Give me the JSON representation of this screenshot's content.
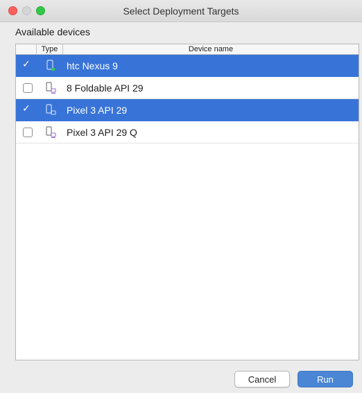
{
  "window": {
    "title": "Select Deployment Targets"
  },
  "section": {
    "label": "Available devices"
  },
  "table": {
    "columns": {
      "type": "Type",
      "name": "Device name"
    },
    "rows": [
      {
        "name": "htc Nexus 9",
        "checked": true,
        "selected": true,
        "icon": "phone-online-icon"
      },
      {
        "name": "8  Foldable API 29",
        "checked": false,
        "selected": false,
        "icon": "phone-emulator-icon"
      },
      {
        "name": "Pixel 3 API 29",
        "checked": true,
        "selected": true,
        "icon": "phone-emulator-icon"
      },
      {
        "name": "Pixel 3 API 29 Q",
        "checked": false,
        "selected": false,
        "icon": "phone-emulator-icon"
      }
    ]
  },
  "buttons": {
    "cancel": "Cancel",
    "run": "Run"
  },
  "colors": {
    "selection": "#3874d8",
    "accent_button": "#4a86d4",
    "device_online_dot": "#34c84a",
    "emulator_badge": "#9b6fcf"
  }
}
